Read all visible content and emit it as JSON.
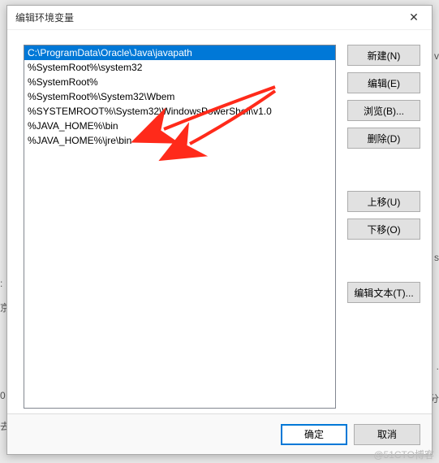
{
  "dialog": {
    "title": "编辑环境变量",
    "close_glyph": "✕"
  },
  "path_entries": [
    "C:\\ProgramData\\Oracle\\Java\\javapath",
    "%SystemRoot%\\system32",
    "%SystemRoot%",
    "%SystemRoot%\\System32\\Wbem",
    "%SYSTEMROOT%\\System32\\WindowsPowerShell\\v1.0",
    "%JAVA_HOME%\\bin",
    "%JAVA_HOME%\\jre\\bin"
  ],
  "selected_index": 0,
  "buttons": {
    "new": "新建(N)",
    "edit": "编辑(E)",
    "browse": "浏览(B)...",
    "delete": "删除(D)",
    "move_up": "上移(U)",
    "move_down": "下移(O)",
    "edit_text": "编辑文本(T)...",
    "ok": "确定",
    "cancel": "取消"
  },
  "watermark": "@51CTO博客",
  "arrow_color": "#ff2a1a"
}
